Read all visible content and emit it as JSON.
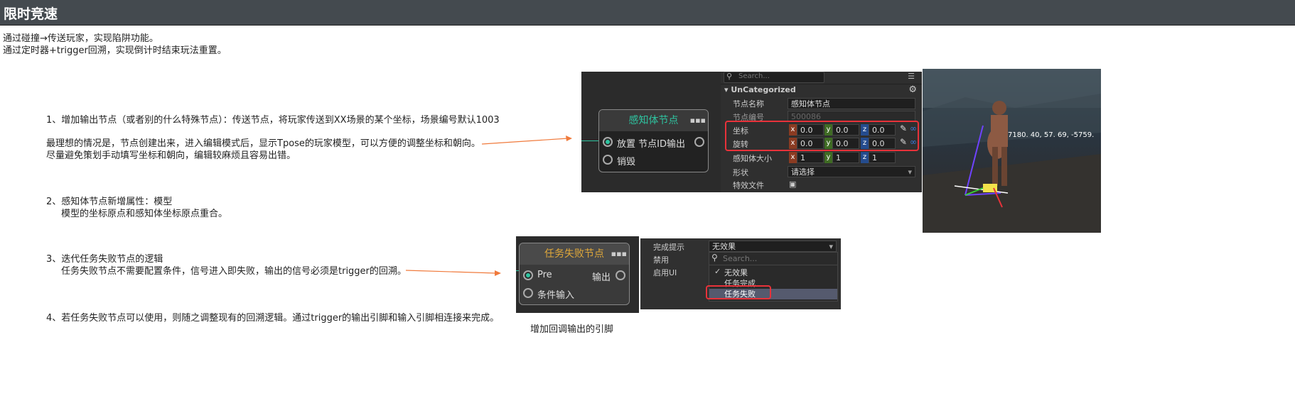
{
  "header": {
    "title": "限时竞速"
  },
  "intro": {
    "line1": "通过碰撞→传送玩家，实现陷阱功能。",
    "line2": "通过定时器+trigger回溯，实现倒计时结束玩法重置。"
  },
  "items": [
    {
      "text": "1、增加输出节点（或者别的什么特殊节点）：传送节点，将玩家传送到XX场景的某个坐标，场景编号默认1003"
    },
    {
      "text": "最理想的情况是，节点创建出来，进入编辑模式后，显示Tpose的玩家模型，可以方便的调整坐标和朝向。"
    },
    {
      "text": "尽量避免策划手动填写坐标和朝向，编辑较麻烦且容易出错。"
    },
    {
      "text": "2、感知体节点新增属性：模型"
    },
    {
      "text": "模型的坐标原点和感知体坐标原点重合。"
    },
    {
      "text": "3、迭代任务失败节点的逻辑"
    },
    {
      "text": "任务失败节点不需要配置条件，信号进入即失败，输出的信号必须是trigger的回溯。"
    },
    {
      "text": "4、若任务失败节点可以使用，则随之调整现有的回溯逻辑。通过trigger的输出引脚和输入引脚相连接来完成。"
    }
  ],
  "node1": {
    "title": "感知体节点",
    "pin_place": "放置",
    "pin_out": "节点ID输出",
    "pin_destroy": "销毁"
  },
  "props": {
    "search_placeholder": "Search...",
    "section": "UnCategorized",
    "rows": {
      "name_label": "节点名称",
      "name_value": "感知体节点",
      "id_label": "节点编号",
      "id_value": "500086",
      "pos_label": "坐标",
      "rot_label": "旋转",
      "size_label": "感知体大小",
      "shape_label": "形状",
      "shape_value": "请选择",
      "fx_label": "特效文件"
    },
    "axes": {
      "x": "x",
      "y": "y",
      "z": "z"
    },
    "pos": {
      "x": "0.0",
      "y": "0.0",
      "z": "0.0"
    },
    "rot": {
      "x": "0.0",
      "y": "0.0",
      "z": "0.0"
    },
    "size": {
      "x": "1",
      "y": "1",
      "z": "1"
    }
  },
  "viewport": {
    "coords": "7180. 40,  57. 69,  -5759."
  },
  "node2": {
    "title": "任务失败节点",
    "pin_pre": "Pre",
    "pin_out": "输出",
    "pin_cond": "条件输入"
  },
  "dropdown_panel": {
    "label_complete": "完成提示",
    "label_disable": "禁用",
    "label_enable_ui": "启用UI",
    "selected": "无效果",
    "search_placeholder": "Search...",
    "options": [
      "无效果",
      "任务完成",
      "任务失败"
    ],
    "check": "✓"
  },
  "caption": "增加回调输出的引脚",
  "colors": {
    "accent_red": "#e8323a",
    "arrow": "#f07a3c",
    "node_title_green": "#2ec4a0",
    "node_title_gold": "#e0a83a"
  }
}
